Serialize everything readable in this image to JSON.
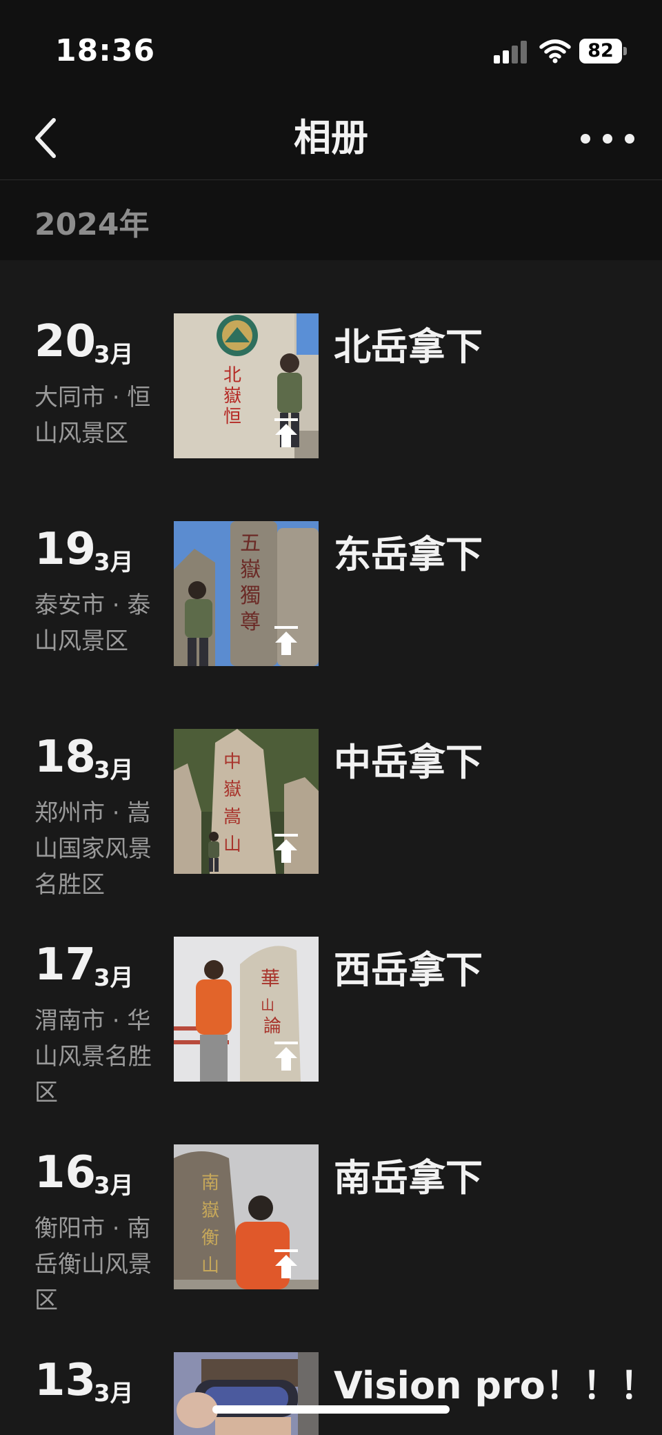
{
  "status_bar": {
    "time": "18:36",
    "battery": "82"
  },
  "nav": {
    "title": "相册",
    "back_icon": "chevron-left-icon",
    "more_icon": "more-dots-icon"
  },
  "year_label": "2024年",
  "entries": [
    {
      "day": "20",
      "month": "3月",
      "location": "大同市 · 恒山风景区",
      "caption": "北岳拿下"
    },
    {
      "day": "19",
      "month": "3月",
      "location": "泰安市 · 泰山风景区",
      "caption": "东岳拿下"
    },
    {
      "day": "18",
      "month": "3月",
      "location": "郑州市 · 嵩山国家风景名胜区",
      "caption": "中岳拿下"
    },
    {
      "day": "17",
      "month": "3月",
      "location": "渭南市 · 华山风景名胜区",
      "caption": "西岳拿下"
    },
    {
      "day": "16",
      "month": "3月",
      "location": "衡阳市 · 南岳衡山风景区",
      "caption": "南岳拿下"
    },
    {
      "day": "13",
      "month": "3月",
      "location": "",
      "caption": "Vision pro！！！"
    }
  ]
}
